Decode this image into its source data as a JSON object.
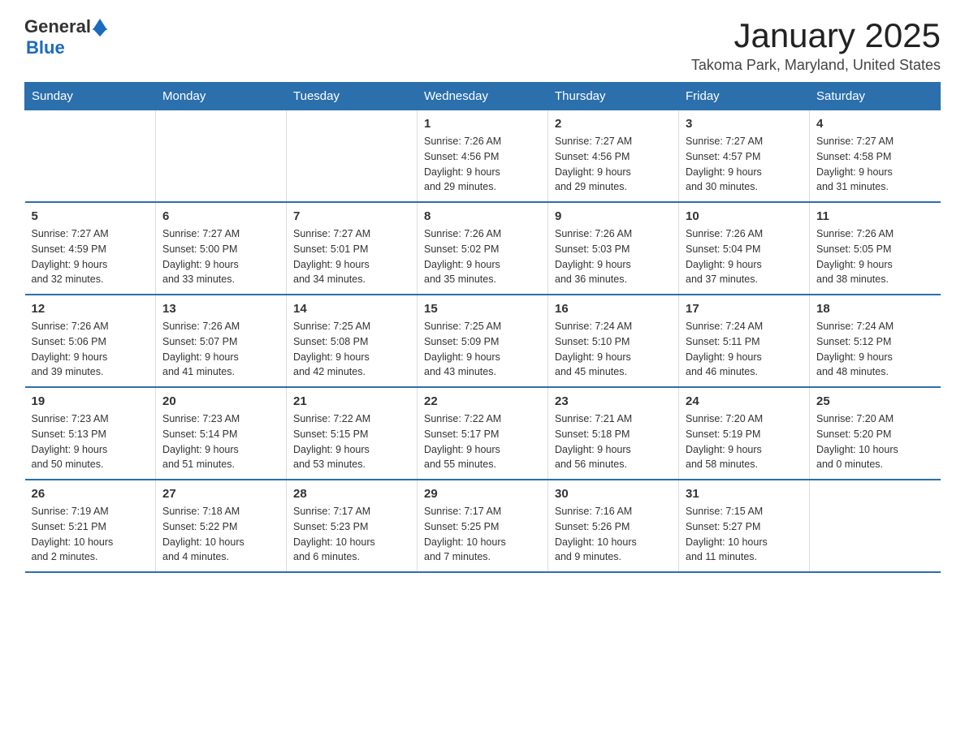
{
  "header": {
    "logo_general": "General",
    "logo_blue": "Blue",
    "title": "January 2025",
    "subtitle": "Takoma Park, Maryland, United States"
  },
  "weekdays": [
    "Sunday",
    "Monday",
    "Tuesday",
    "Wednesday",
    "Thursday",
    "Friday",
    "Saturday"
  ],
  "weeks": [
    [
      {
        "day": "",
        "info": ""
      },
      {
        "day": "",
        "info": ""
      },
      {
        "day": "",
        "info": ""
      },
      {
        "day": "1",
        "info": "Sunrise: 7:26 AM\nSunset: 4:56 PM\nDaylight: 9 hours\nand 29 minutes."
      },
      {
        "day": "2",
        "info": "Sunrise: 7:27 AM\nSunset: 4:56 PM\nDaylight: 9 hours\nand 29 minutes."
      },
      {
        "day": "3",
        "info": "Sunrise: 7:27 AM\nSunset: 4:57 PM\nDaylight: 9 hours\nand 30 minutes."
      },
      {
        "day": "4",
        "info": "Sunrise: 7:27 AM\nSunset: 4:58 PM\nDaylight: 9 hours\nand 31 minutes."
      }
    ],
    [
      {
        "day": "5",
        "info": "Sunrise: 7:27 AM\nSunset: 4:59 PM\nDaylight: 9 hours\nand 32 minutes."
      },
      {
        "day": "6",
        "info": "Sunrise: 7:27 AM\nSunset: 5:00 PM\nDaylight: 9 hours\nand 33 minutes."
      },
      {
        "day": "7",
        "info": "Sunrise: 7:27 AM\nSunset: 5:01 PM\nDaylight: 9 hours\nand 34 minutes."
      },
      {
        "day": "8",
        "info": "Sunrise: 7:26 AM\nSunset: 5:02 PM\nDaylight: 9 hours\nand 35 minutes."
      },
      {
        "day": "9",
        "info": "Sunrise: 7:26 AM\nSunset: 5:03 PM\nDaylight: 9 hours\nand 36 minutes."
      },
      {
        "day": "10",
        "info": "Sunrise: 7:26 AM\nSunset: 5:04 PM\nDaylight: 9 hours\nand 37 minutes."
      },
      {
        "day": "11",
        "info": "Sunrise: 7:26 AM\nSunset: 5:05 PM\nDaylight: 9 hours\nand 38 minutes."
      }
    ],
    [
      {
        "day": "12",
        "info": "Sunrise: 7:26 AM\nSunset: 5:06 PM\nDaylight: 9 hours\nand 39 minutes."
      },
      {
        "day": "13",
        "info": "Sunrise: 7:26 AM\nSunset: 5:07 PM\nDaylight: 9 hours\nand 41 minutes."
      },
      {
        "day": "14",
        "info": "Sunrise: 7:25 AM\nSunset: 5:08 PM\nDaylight: 9 hours\nand 42 minutes."
      },
      {
        "day": "15",
        "info": "Sunrise: 7:25 AM\nSunset: 5:09 PM\nDaylight: 9 hours\nand 43 minutes."
      },
      {
        "day": "16",
        "info": "Sunrise: 7:24 AM\nSunset: 5:10 PM\nDaylight: 9 hours\nand 45 minutes."
      },
      {
        "day": "17",
        "info": "Sunrise: 7:24 AM\nSunset: 5:11 PM\nDaylight: 9 hours\nand 46 minutes."
      },
      {
        "day": "18",
        "info": "Sunrise: 7:24 AM\nSunset: 5:12 PM\nDaylight: 9 hours\nand 48 minutes."
      }
    ],
    [
      {
        "day": "19",
        "info": "Sunrise: 7:23 AM\nSunset: 5:13 PM\nDaylight: 9 hours\nand 50 minutes."
      },
      {
        "day": "20",
        "info": "Sunrise: 7:23 AM\nSunset: 5:14 PM\nDaylight: 9 hours\nand 51 minutes."
      },
      {
        "day": "21",
        "info": "Sunrise: 7:22 AM\nSunset: 5:15 PM\nDaylight: 9 hours\nand 53 minutes."
      },
      {
        "day": "22",
        "info": "Sunrise: 7:22 AM\nSunset: 5:17 PM\nDaylight: 9 hours\nand 55 minutes."
      },
      {
        "day": "23",
        "info": "Sunrise: 7:21 AM\nSunset: 5:18 PM\nDaylight: 9 hours\nand 56 minutes."
      },
      {
        "day": "24",
        "info": "Sunrise: 7:20 AM\nSunset: 5:19 PM\nDaylight: 9 hours\nand 58 minutes."
      },
      {
        "day": "25",
        "info": "Sunrise: 7:20 AM\nSunset: 5:20 PM\nDaylight: 10 hours\nand 0 minutes."
      }
    ],
    [
      {
        "day": "26",
        "info": "Sunrise: 7:19 AM\nSunset: 5:21 PM\nDaylight: 10 hours\nand 2 minutes."
      },
      {
        "day": "27",
        "info": "Sunrise: 7:18 AM\nSunset: 5:22 PM\nDaylight: 10 hours\nand 4 minutes."
      },
      {
        "day": "28",
        "info": "Sunrise: 7:17 AM\nSunset: 5:23 PM\nDaylight: 10 hours\nand 6 minutes."
      },
      {
        "day": "29",
        "info": "Sunrise: 7:17 AM\nSunset: 5:25 PM\nDaylight: 10 hours\nand 7 minutes."
      },
      {
        "day": "30",
        "info": "Sunrise: 7:16 AM\nSunset: 5:26 PM\nDaylight: 10 hours\nand 9 minutes."
      },
      {
        "day": "31",
        "info": "Sunrise: 7:15 AM\nSunset: 5:27 PM\nDaylight: 10 hours\nand 11 minutes."
      },
      {
        "day": "",
        "info": ""
      }
    ]
  ]
}
